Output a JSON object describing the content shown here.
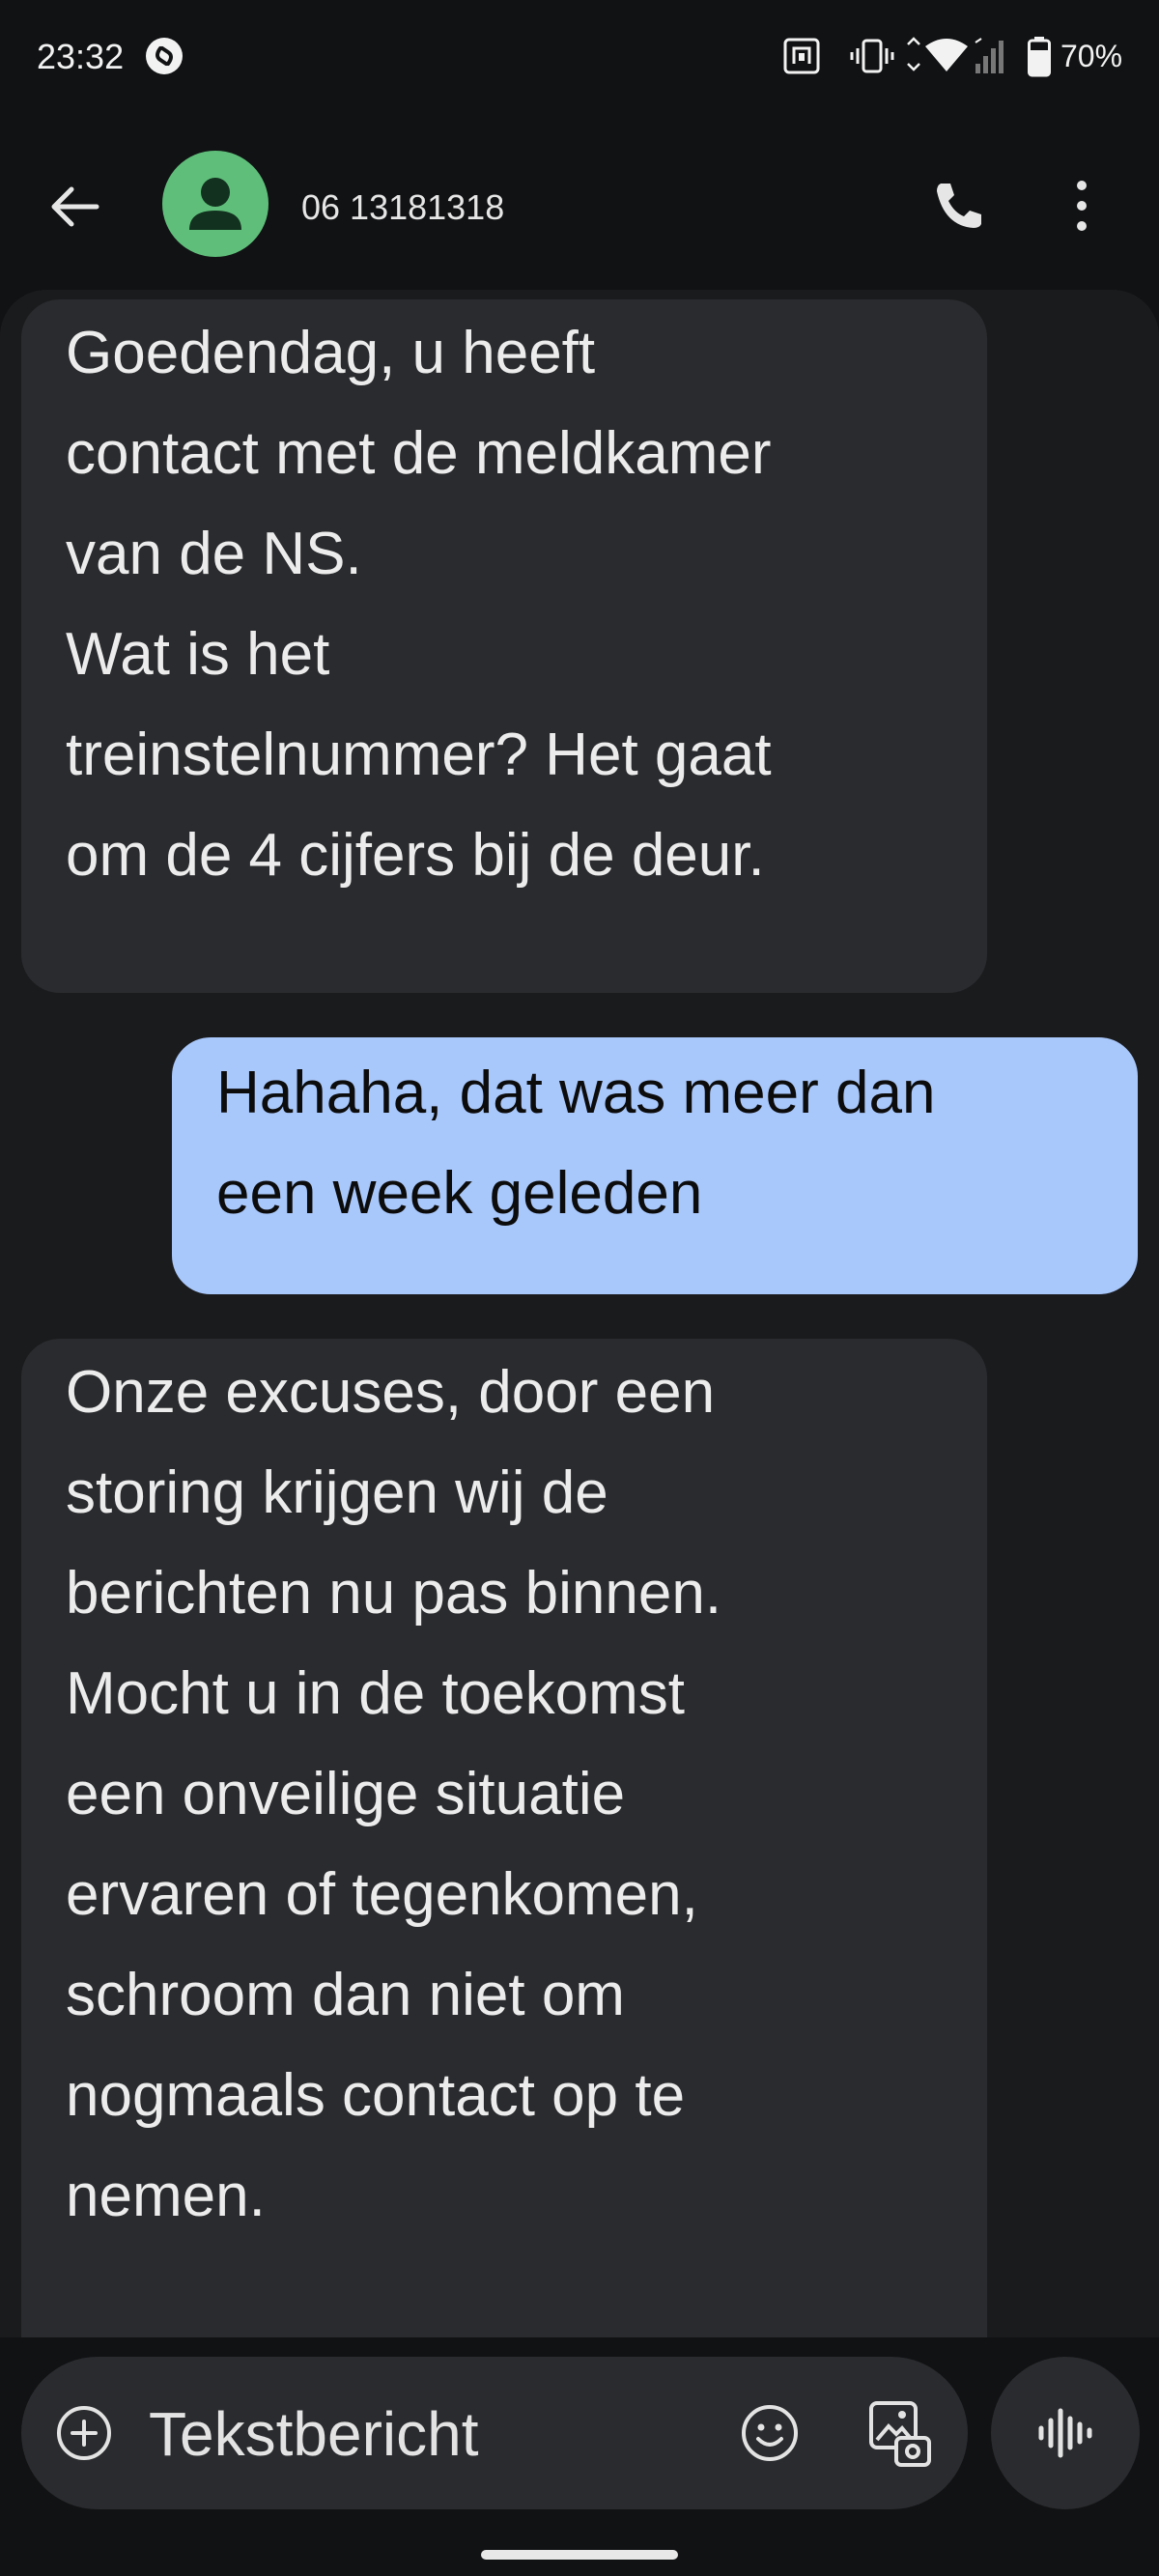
{
  "status_bar": {
    "time": "23:32",
    "battery": "70%",
    "icons": [
      "shazam-icon",
      "nfc-icon",
      "vibrate-icon",
      "wifi-icon",
      "signal-icon",
      "battery-icon"
    ]
  },
  "header": {
    "contact": "06 13181318",
    "icons": [
      "back-arrow-icon",
      "person-icon",
      "phone-icon",
      "more-vert-icon"
    ]
  },
  "messages": [
    {
      "direction": "incoming",
      "text": "Goedendag, u heeft\ncontact met de meldkamer\nvan de NS.\nWat is het\ntreinstelnummer? Het gaat\nom de 4 cijfers bij de deur."
    },
    {
      "direction": "outgoing",
      "text": "Hahaha, dat was meer dan\neen week geleden"
    },
    {
      "direction": "incoming",
      "text": "  Onze excuses, door een\nstoring krijgen wij de\nberichten nu pas binnen.\nMocht u in de toekomst\neen onveilige situatie\nervaren of tegenkomen,\nschroom dan niet om\nnogmaals contact op te\nnemen."
    }
  ],
  "compose": {
    "placeholder": "Tekstbericht",
    "icons": [
      "add-circle-icon",
      "emoji-icon",
      "media-gallery-icon",
      "voice-wave-icon"
    ]
  },
  "colors": {
    "background": "#111214",
    "conversation_bg": "#1a1b1d",
    "incoming_bubble": "#2a2b2e",
    "outgoing_bubble": "#a8c7fa",
    "avatar": "#5fbf7a"
  }
}
